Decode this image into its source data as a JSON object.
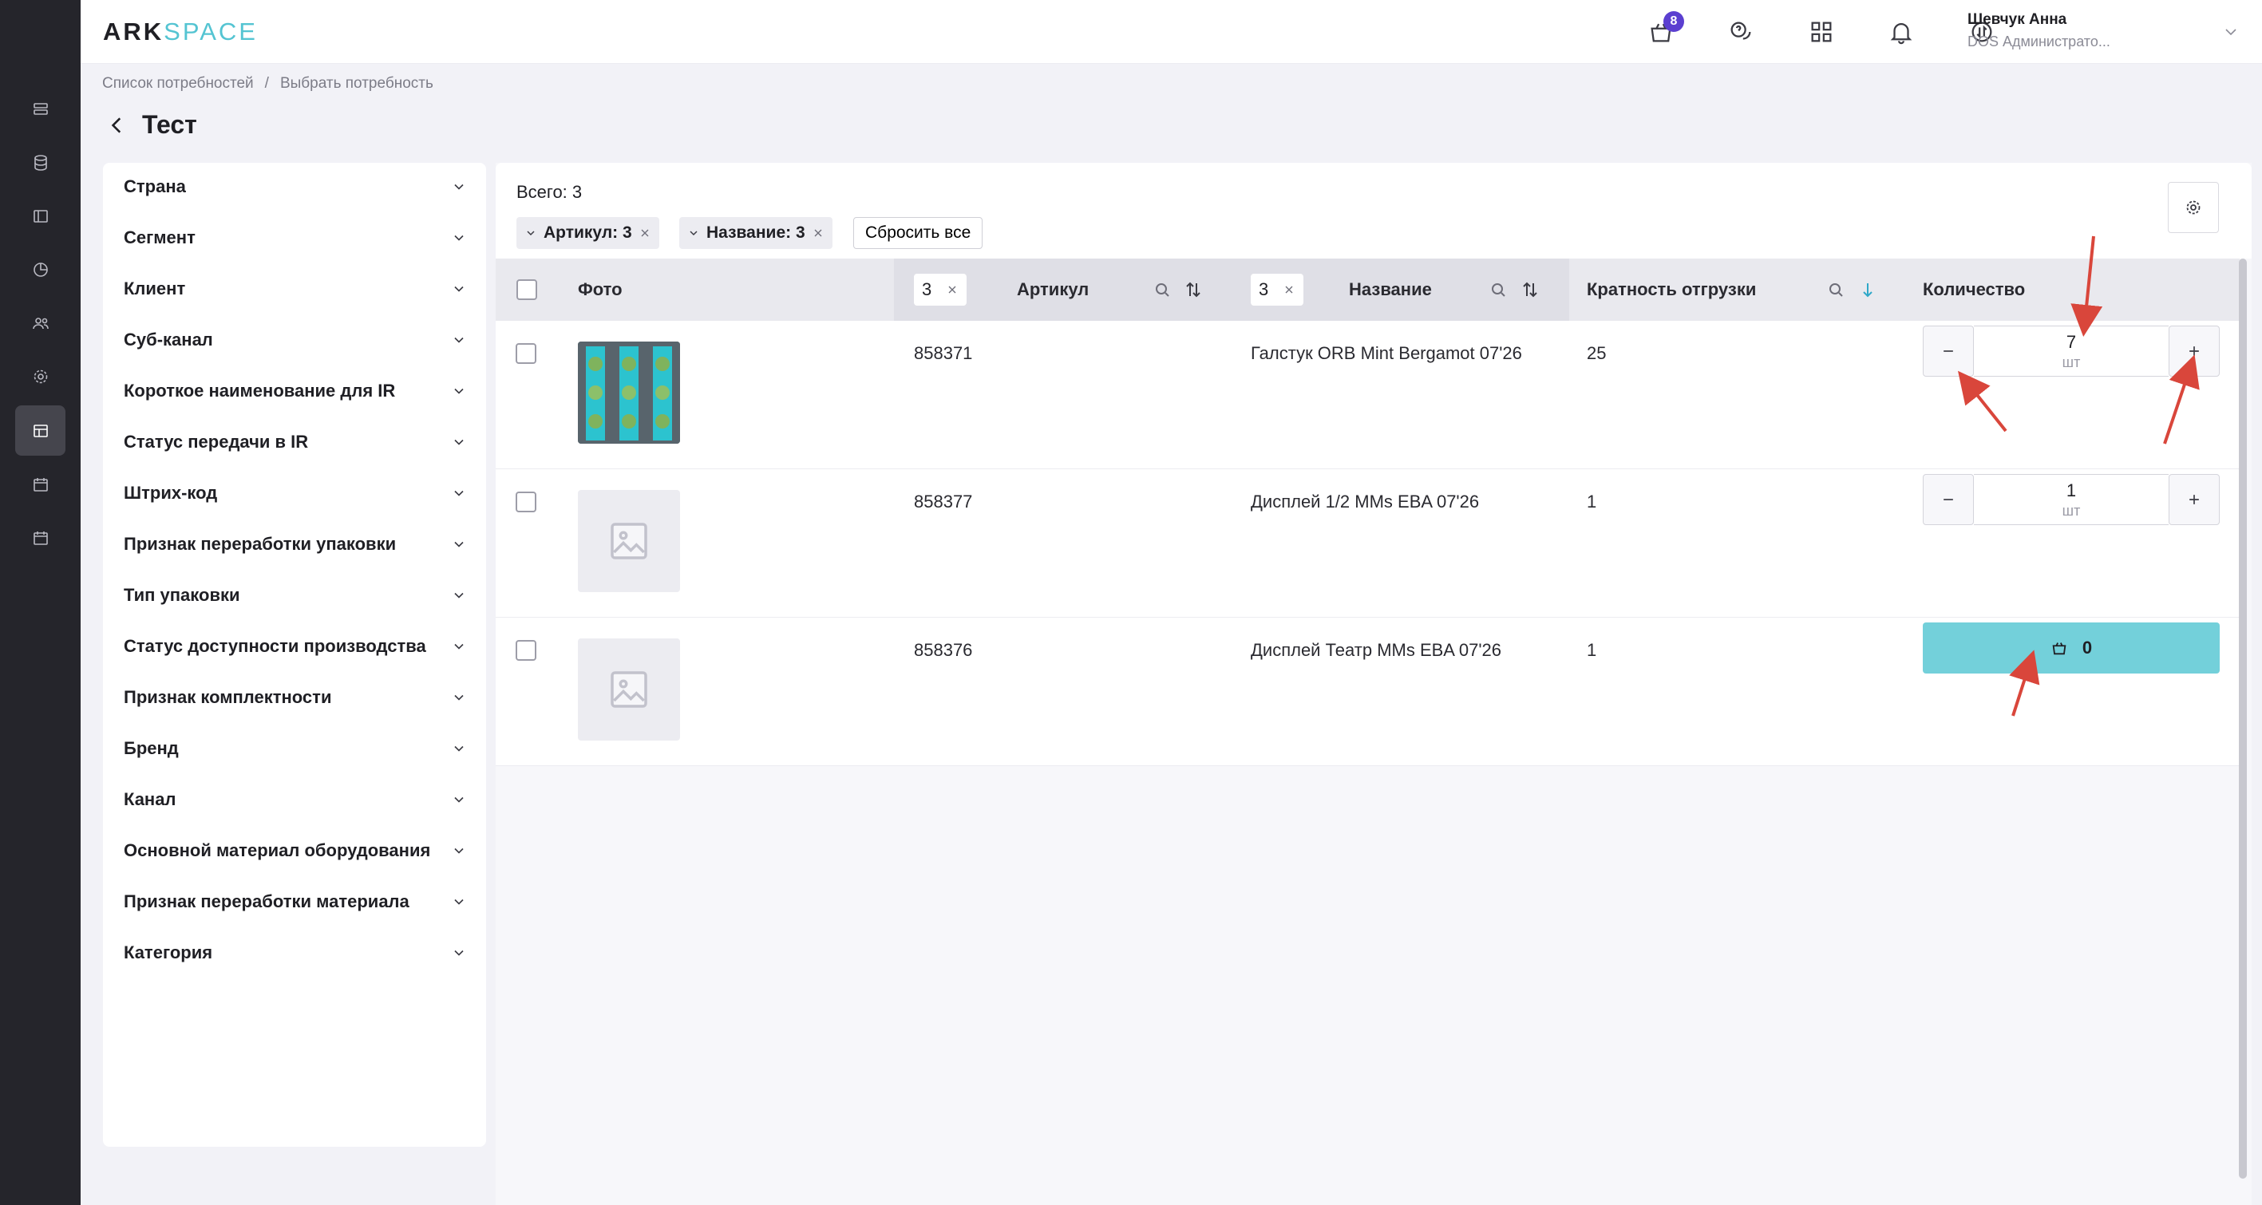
{
  "app": {
    "logo_primary": "ARK",
    "logo_secondary": "SPACE"
  },
  "rail": {
    "items": [
      {
        "icon": "list-check-icon"
      },
      {
        "icon": "database-icon"
      },
      {
        "icon": "layout-icon"
      },
      {
        "icon": "chart-pie-icon"
      },
      {
        "icon": "users-icon"
      },
      {
        "icon": "gear-icon"
      },
      {
        "icon": "table-edit-icon",
        "active": true
      },
      {
        "icon": "calendar-icon"
      },
      {
        "icon": "calendar-icon"
      }
    ]
  },
  "header": {
    "cart_count": "8",
    "icons": [
      "cart-icon",
      "chat-help-icon",
      "apps-grid-icon",
      "bell-icon",
      "sync-icon"
    ],
    "user_name": "Шевчук Анна",
    "user_role": "DOS Администрато..."
  },
  "breadcrumb": {
    "items": [
      "Список потребностей",
      "/",
      "Выбрать потребность"
    ]
  },
  "page": {
    "title": "Тест"
  },
  "filters": [
    "Страна",
    "Сегмент",
    "Клиент",
    "Суб-канал",
    "Короткое наименование для IR",
    "Статус передачи в IR",
    "Штрих-код",
    "Признак переработки упаковки",
    "Тип упаковки",
    "Статус доступности производства",
    "Признак комплектности",
    "Бренд",
    "Канал",
    "Основной материал оборудования",
    "Признак переработки материала",
    "Категория"
  ],
  "table": {
    "total_label": "Всего: 3",
    "chips": [
      {
        "label": "Артикул: 3"
      },
      {
        "label": "Название: 3"
      }
    ],
    "reset_label": "Сбросить все",
    "headers": {
      "photo": "Фото",
      "article_filter": "3",
      "article": "Артикул",
      "name_filter": "3",
      "name": "Название",
      "multiplicity": "Кратность отгрузки",
      "quantity": "Количество"
    },
    "rows": [
      {
        "article": "858371",
        "name": "Галстук ORB Mint Bergamot 07'26",
        "multiplicity": "25",
        "qty": "7",
        "unit": "шт",
        "mode": "stepper",
        "has_photo": true
      },
      {
        "article": "858377",
        "name": "Дисплей 1/2 MMs EBA 07'26",
        "multiplicity": "1",
        "qty": "1",
        "unit": "шт",
        "mode": "stepper",
        "has_photo": false
      },
      {
        "article": "858376",
        "name": "Дисплей Театр MMs EBA 07'26",
        "multiplicity": "1",
        "qty": "0",
        "unit": "",
        "mode": "cart",
        "has_photo": false
      }
    ]
  },
  "colors": {
    "rail_bg": "#25252b",
    "accent_teal": "#73d0da",
    "badge_purple": "#5b3fd0",
    "annotation_red": "#d9463b"
  }
}
